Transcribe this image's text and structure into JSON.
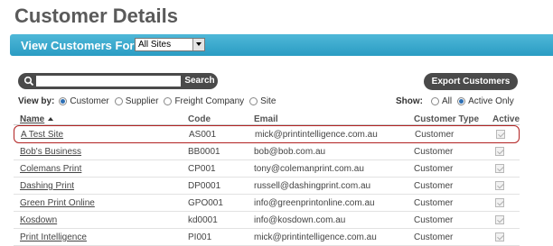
{
  "page": {
    "title": "Customer Details"
  },
  "site_filter": {
    "label": "View Customers For",
    "selected": "All Sites"
  },
  "search": {
    "placeholder": "",
    "value": "",
    "button_label": "Search"
  },
  "export": {
    "label": "Export Customers"
  },
  "view_by": {
    "label": "View by:",
    "options": [
      "Customer",
      "Supplier",
      "Freight Company",
      "Site"
    ],
    "selected": "Customer"
  },
  "show": {
    "label": "Show:",
    "options": [
      "All",
      "Active Only"
    ],
    "selected": "Active Only"
  },
  "table": {
    "columns": [
      "Name",
      "Code",
      "Email",
      "Customer Type",
      "Active"
    ],
    "sort_column": "Name",
    "sort_direction": "ascending",
    "rows": [
      {
        "name": "A Test Site",
        "code": "AS001",
        "email": "mick@printintelligence.com.au",
        "type": "Customer",
        "active": true,
        "selected": true
      },
      {
        "name": "Bob's Business",
        "code": "BB0001",
        "email": "bob@bob.com.au",
        "type": "Customer",
        "active": true
      },
      {
        "name": "Colemans Print",
        "code": "CP001",
        "email": "tony@colemanprint.com.au",
        "type": "Customer",
        "active": true
      },
      {
        "name": "Dashing Print",
        "code": "DP0001",
        "email": "russell@dashingprint.com.au",
        "type": "Customer",
        "active": true
      },
      {
        "name": "Green Print Online",
        "code": "GPO001",
        "email": "info@greenprintonline.com.au",
        "type": "Customer",
        "active": true
      },
      {
        "name": "Kosdown",
        "code": "kd0001",
        "email": "info@kosdown.com.au",
        "type": "Customer",
        "active": true
      },
      {
        "name": "Print Intelligence",
        "code": "PI001",
        "email": "mick@printintelligence.com.au",
        "type": "Customer",
        "active": true
      }
    ]
  },
  "colors": {
    "header_bar": "#2a9cc3",
    "dark_button": "#4a4a4a",
    "selection_outline": "#b22222"
  }
}
